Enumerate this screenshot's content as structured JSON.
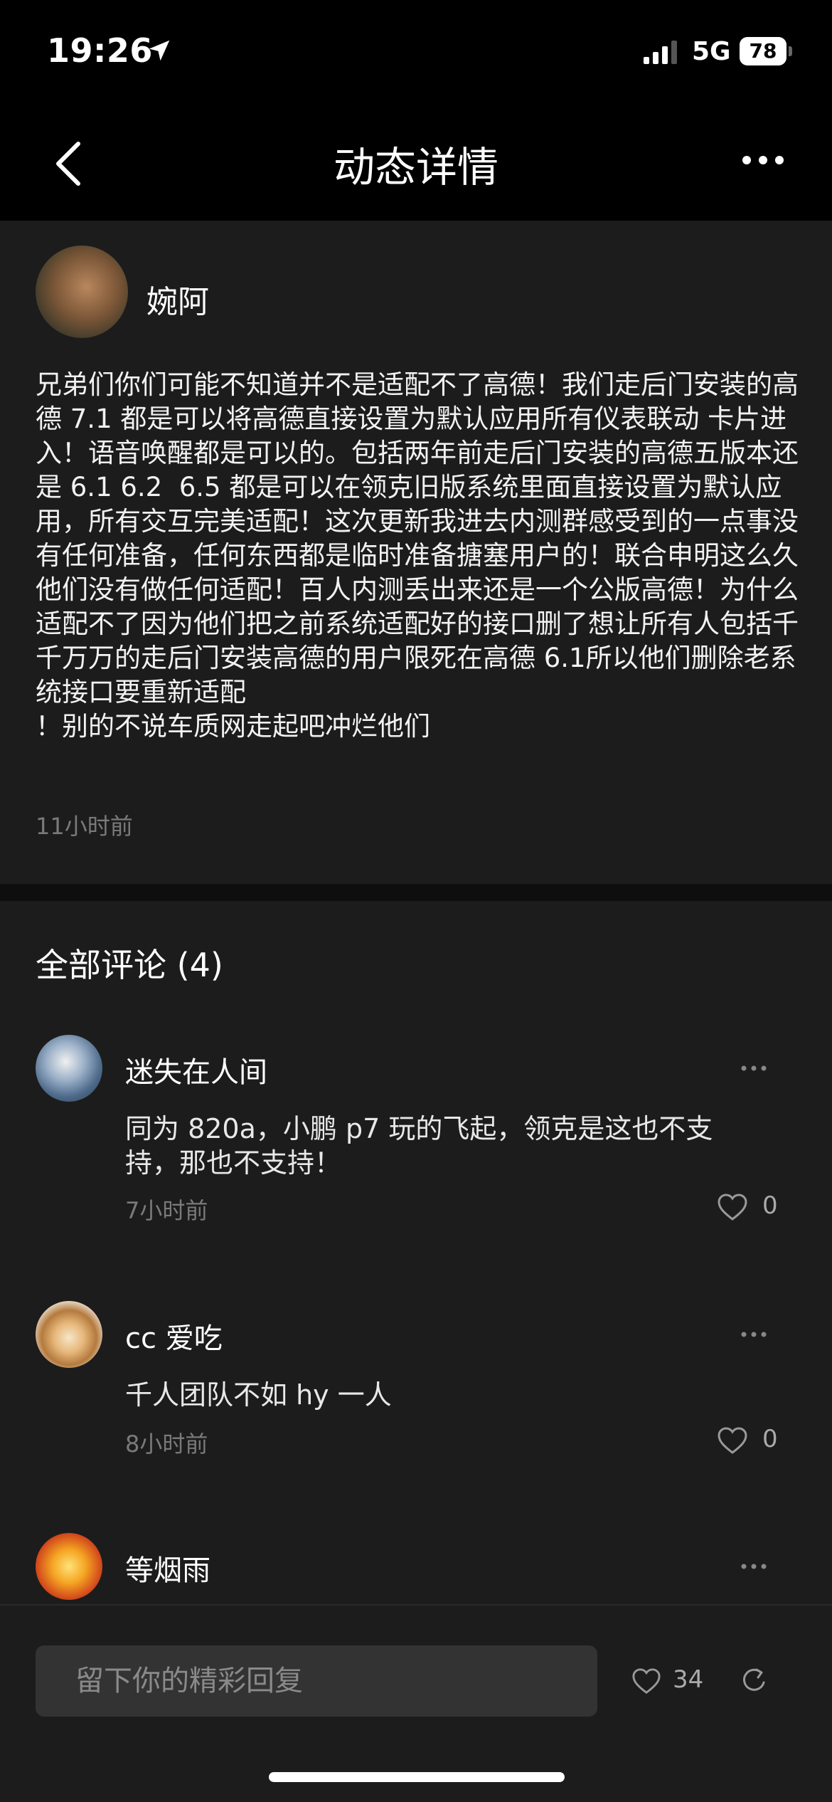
{
  "status_bar": {
    "time": "19:26",
    "network": "5G",
    "battery": "78"
  },
  "nav": {
    "title": "动态详情",
    "back_icon": "chevron-left-icon",
    "more_icon": "ellipsis-icon"
  },
  "post": {
    "author": "婉阿",
    "body": "兄弟们你们可能不知道并不是适配不了高德！我们走后门安装的高德 7.1 都是可以将高德直接设置为默认应用所有仪表联动 卡片进入！语音唤醒都是可以的。包括两年前走后门安装的高德五版本还是 6.1 6.2  6.5 都是可以在领克旧版系统里面直接设置为默认应用，所有交互完美适配！这次更新我进去内测群感受到的一点事没有任何准备，任何东西都是临时准备搪塞用户的！联合申明这么久他们没有做任何适配！百人内测丢出来还是一个公版高德！为什么适配不了因为他们把之前系统适配好的接口删了想让所有人包括千千万万的走后门安装高德的用户限死在高德 6.1所以他们删除老系统接口要重新适配\n！别的不说车质网走起吧冲烂他们",
    "time": "11小时前"
  },
  "comments": {
    "title": "全部评论 (4)",
    "items": [
      {
        "name": "迷失在人间",
        "text": "同为 820a，小鹏 p7 玩的飞起，领克是这也不支持，那也不支持！",
        "time": "7小时前",
        "likes": "0"
      },
      {
        "name": "cc 爱吃",
        "text": "千人团队不如 hy 一人",
        "time": "8小时前",
        "likes": "0"
      },
      {
        "name": "等烟雨",
        "text": "",
        "time": "",
        "likes": ""
      }
    ]
  },
  "bottom_bar": {
    "reply_placeholder": "留下你的精彩回复",
    "likes": "34",
    "share_icon": "share-icon"
  },
  "colors": {
    "background": "#1c1c1c",
    "header": "#000000",
    "muted_text": "#7a7a7a",
    "input_bg": "#333333"
  }
}
